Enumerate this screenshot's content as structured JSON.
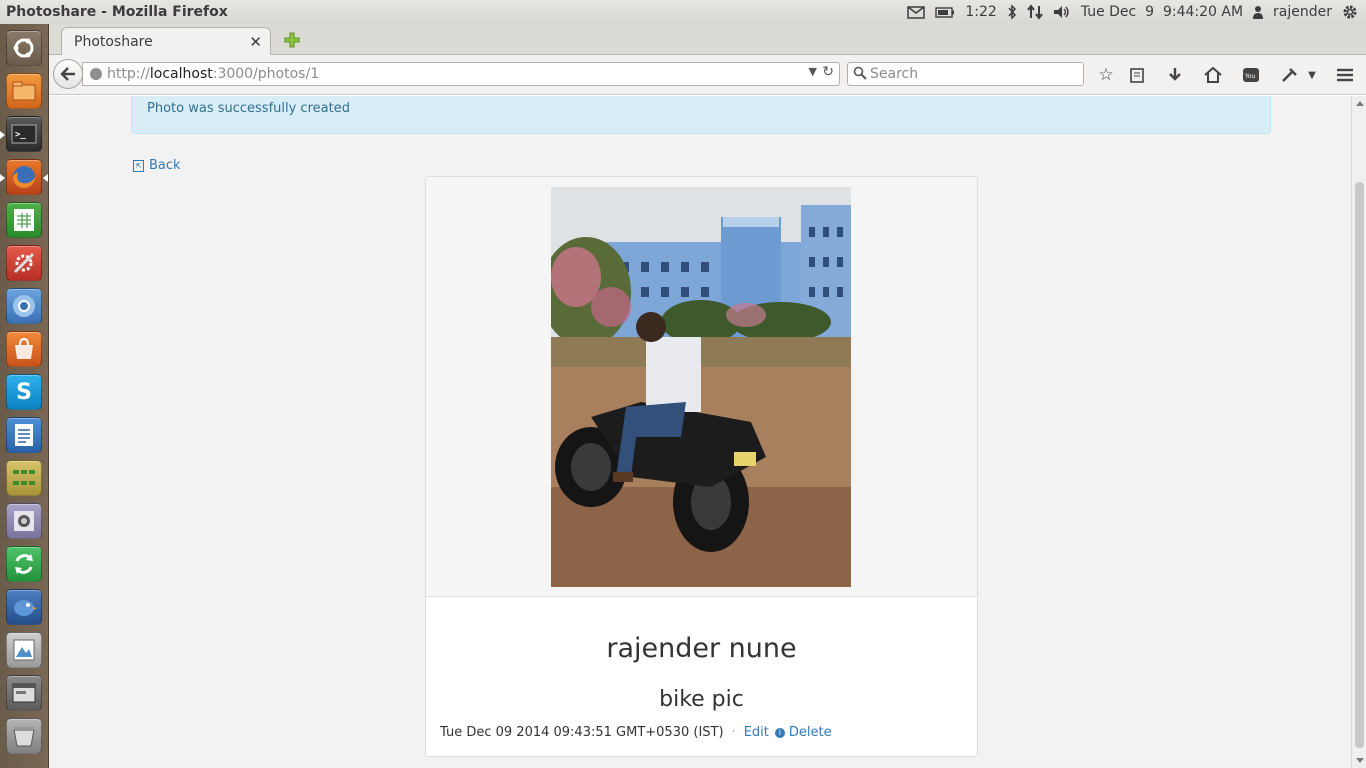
{
  "top_panel": {
    "window_title": "Photoshare - Mozilla Firefox",
    "battery_time": "1:22",
    "clock": "Tue Dec  9  9:44:20 AM",
    "user": "rajender"
  },
  "launcher": {
    "items": [
      "dash-home",
      "files",
      "terminal",
      "firefox",
      "libreoffice-calc",
      "system-settings",
      "chromium",
      "software-center",
      "skype",
      "libreoffice-writer",
      "workspaces",
      "webcam",
      "backup",
      "bird-app",
      "image-viewer",
      "window-app",
      "trash"
    ]
  },
  "browser": {
    "tab_title": "Photoshare",
    "url_scheme": "http://",
    "url_host": "localhost",
    "url_path": ":3000/photos/1",
    "search_placeholder": "Search"
  },
  "page": {
    "flash_notice": "Photo was successfully created",
    "back_label": "Back",
    "photo": {
      "author": "rajender nune",
      "caption": "bike pic",
      "timestamp": "Tue Dec 09 2014 09:43:51 GMT+0530 (IST)",
      "separator": "·",
      "edit_label": "Edit",
      "delete_label": "Delete"
    }
  },
  "colors": {
    "link": "#337ab7",
    "alert_bg": "#d9edf7",
    "alert_text": "#31708f",
    "launcher_bg": "#6b5b4a"
  }
}
